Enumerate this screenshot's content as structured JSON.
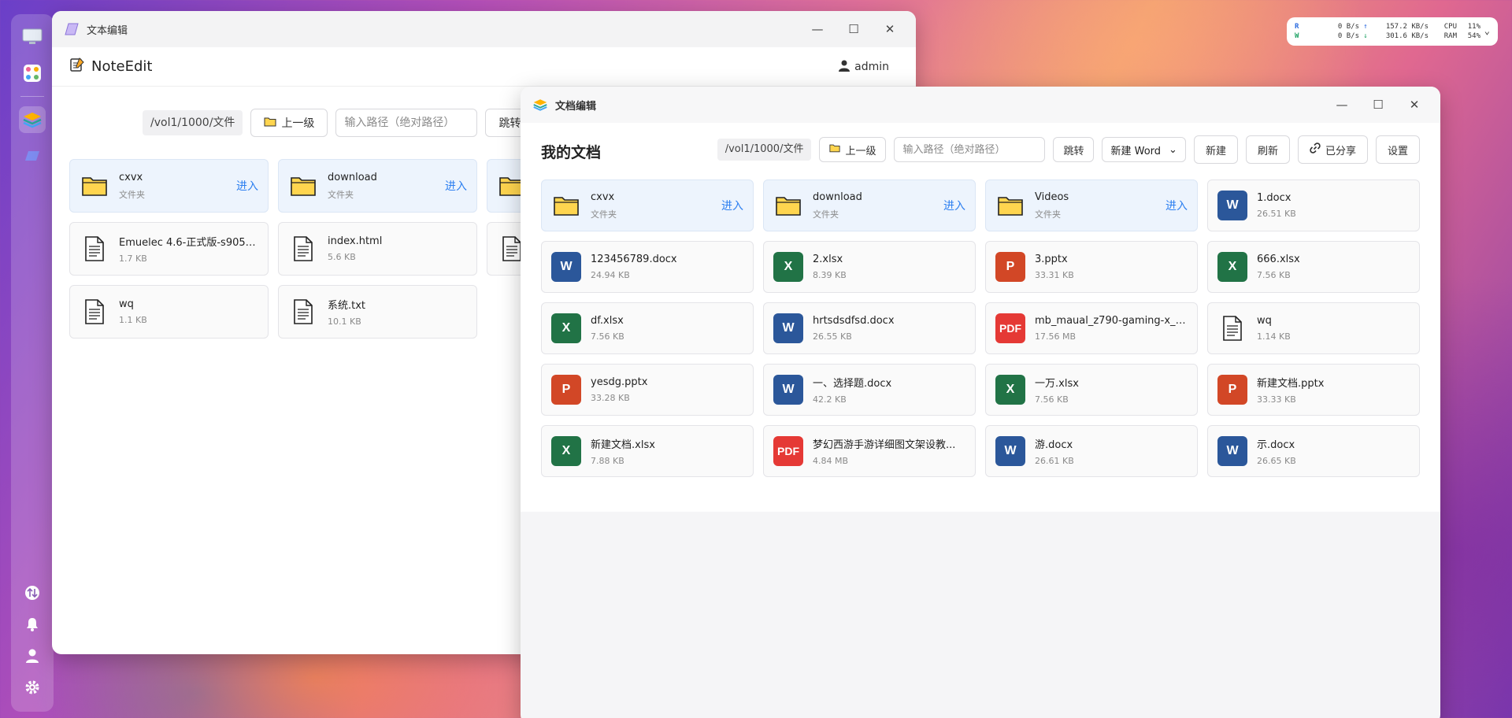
{
  "noteedit": {
    "window_title": "文本编辑",
    "brand": "NoteEdit",
    "user": "admin",
    "path": "/vol1/1000/文件",
    "up_label": "上一级",
    "path_placeholder": "输入路径（绝对路径）",
    "jump_label": "跳转",
    "items": [
      {
        "name": "cxvx",
        "meta": "文件夹",
        "type": "folder",
        "enter": "进入"
      },
      {
        "name": "download",
        "meta": "文件夹",
        "type": "folder",
        "enter": "进入"
      },
      {
        "name": "",
        "meta": "",
        "type": "folder",
        "enter": ""
      },
      {
        "name": "Emuelec 4.6-正式版-s905x...",
        "meta": "1.7 KB",
        "type": "file"
      },
      {
        "name": "index.html",
        "meta": "5.6 KB",
        "type": "file"
      },
      {
        "name": "",
        "meta": "",
        "type": "file"
      },
      {
        "name": "wq",
        "meta": "1.1 KB",
        "type": "file"
      },
      {
        "name": "系统.txt",
        "meta": "10.1 KB",
        "type": "file"
      }
    ]
  },
  "docedit": {
    "window_title": "文档编辑",
    "heading": "我的文档",
    "path": "/vol1/1000/文件",
    "up_label": "上一级",
    "path_placeholder": "输入路径（绝对路径）",
    "jump_label": "跳转",
    "new_select": "新建 Word",
    "new_label": "新建",
    "refresh_label": "刷新",
    "shared_label": "已分享",
    "settings_label": "设置",
    "items": [
      {
        "name": "cxvx",
        "meta": "文件夹",
        "type": "folder",
        "enter": "进入"
      },
      {
        "name": "download",
        "meta": "文件夹",
        "type": "folder",
        "enter": "进入"
      },
      {
        "name": "Videos",
        "meta": "文件夹",
        "type": "folder",
        "enter": "进入"
      },
      {
        "name": "1.docx",
        "meta": "26.51 KB",
        "type": "w"
      },
      {
        "name": "123456789.docx",
        "meta": "24.94 KB",
        "type": "w"
      },
      {
        "name": "2.xlsx",
        "meta": "8.39 KB",
        "type": "x"
      },
      {
        "name": "3.pptx",
        "meta": "33.31 KB",
        "type": "p"
      },
      {
        "name": "666.xlsx",
        "meta": "7.56 KB",
        "type": "x"
      },
      {
        "name": "df.xlsx",
        "meta": "7.56 KB",
        "type": "x"
      },
      {
        "name": "hrtsdsdfsd.docx",
        "meta": "26.55 KB",
        "type": "w"
      },
      {
        "name": "mb_maual_z790-gaming-x_ax...",
        "meta": "17.56 MB",
        "type": "pdf"
      },
      {
        "name": "wq",
        "meta": "1.14 KB",
        "type": "file"
      },
      {
        "name": "yesdg.pptx",
        "meta": "33.28 KB",
        "type": "p"
      },
      {
        "name": "一、选择题.docx",
        "meta": "42.2 KB",
        "type": "w"
      },
      {
        "name": "一万.xlsx",
        "meta": "7.56 KB",
        "type": "x"
      },
      {
        "name": "新建文档.pptx",
        "meta": "33.33 KB",
        "type": "p"
      },
      {
        "name": "新建文档.xlsx",
        "meta": "7.88 KB",
        "type": "x"
      },
      {
        "name": "梦幻西游手游详细图文架设教...",
        "meta": "4.84 MB",
        "type": "pdf"
      },
      {
        "name": "游.docx",
        "meta": "26.61 KB",
        "type": "w"
      },
      {
        "name": "示.docx",
        "meta": "26.65 KB",
        "type": "w"
      }
    ]
  },
  "sysmon": {
    "r_label": "R",
    "w_label": "W",
    "r_rate": "0 B/s",
    "w_rate": "0 B/s",
    "up_rate": "157.2 KB/s",
    "down_rate": "301.6 KB/s",
    "cpu_label": "CPU",
    "ram_label": "RAM",
    "cpu": "11%",
    "ram": "54%"
  },
  "badges": {
    "w": "W",
    "x": "X",
    "p": "P",
    "pdf": "PDF"
  }
}
